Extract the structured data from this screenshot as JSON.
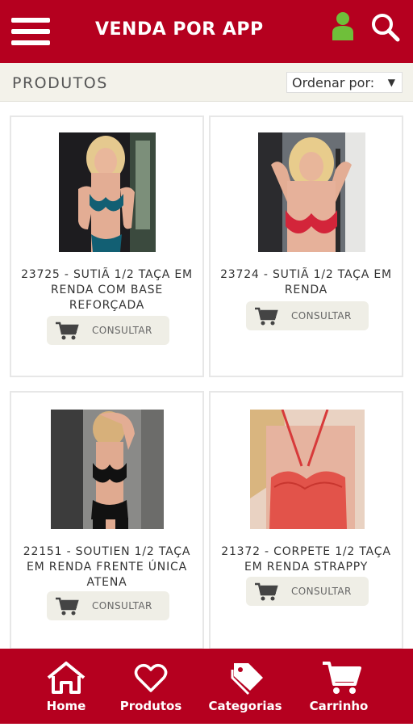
{
  "header": {
    "title": "VENDA POR APP",
    "menu_icon": "hamburger-menu-icon",
    "user_icon": "user-icon",
    "search_icon": "search-icon",
    "brand_color": "#b5001f"
  },
  "toolbar": {
    "title": "PRODUTOS",
    "sort_label": "Ordenar por:",
    "sort_caret": "▼"
  },
  "products": [
    {
      "name": "23725 - SUTIÃ 1/2 TAÇA EM RENDA COM BASE REFORÇADA",
      "button": "CONSULTAR",
      "image": "photo-lingerie-teal"
    },
    {
      "name": "23724 - SUTIÃ 1/2 TAÇA EM RENDA",
      "button": "CONSULTAR",
      "image": "photo-lingerie-red"
    },
    {
      "name": "22151 - SOUTIEN 1/2 TAÇA EM RENDA FRENTE ÚNICA ATENA",
      "button": "CONSULTAR",
      "image": "photo-lingerie-black"
    },
    {
      "name": "21372 - CORPETE 1/2 TAÇA EM RENDA STRAPPY",
      "button": "CONSULTAR",
      "image": "photo-lingerie-coral"
    }
  ],
  "bottom_nav": [
    {
      "label": "Home",
      "icon": "home-icon"
    },
    {
      "label": "Produtos",
      "icon": "heart-icon"
    },
    {
      "label": "Categorias",
      "icon": "tag-icon"
    },
    {
      "label": "Carrinho",
      "icon": "cart-icon"
    }
  ]
}
